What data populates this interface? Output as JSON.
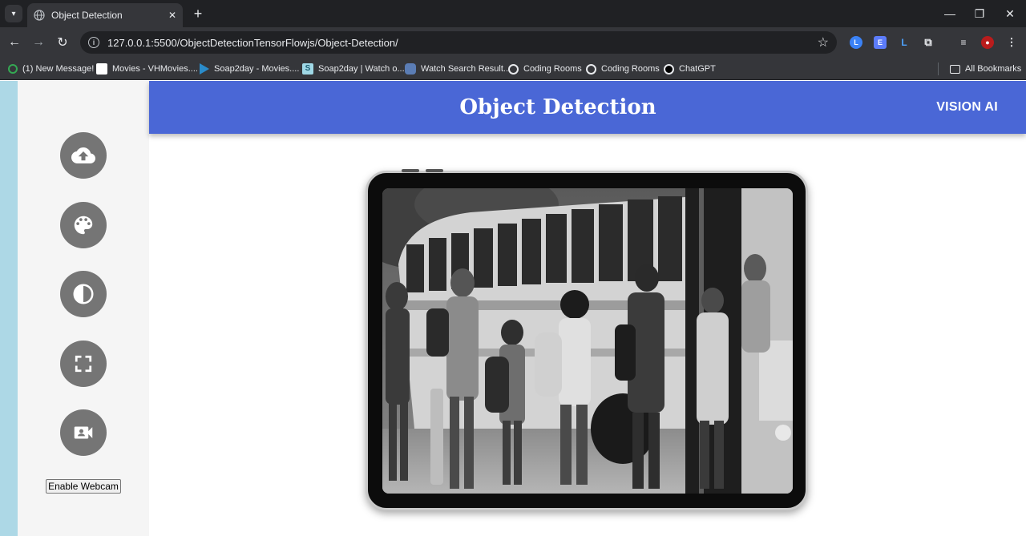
{
  "browser": {
    "tab_title": "Object Detection",
    "url": "127.0.0.1:5500/ObjectDetectionTensorFlowjs/Object-Detection/",
    "bookmarks": [
      {
        "label": "(1) New Message!",
        "icon": "green-circle-icon"
      },
      {
        "label": "Movies - VHMovies....",
        "icon": "white-page-icon"
      },
      {
        "label": "Soap2day - Movies....",
        "icon": "play-icon"
      },
      {
        "label": "Soap2day | Watch o...",
        "icon": "s-logo-icon"
      },
      {
        "label": "Watch Search Result...",
        "icon": "binoculars-icon"
      },
      {
        "label": "Coding Rooms",
        "icon": "coding-rooms-icon"
      },
      {
        "label": "Coding Rooms",
        "icon": "coding-rooms-icon"
      },
      {
        "label": "ChatGPT",
        "icon": "chatgpt-icon"
      }
    ],
    "all_bookmarks_label": "All Bookmarks"
  },
  "header": {
    "title": "Object Detection",
    "brand": "VISION AI",
    "color": "#4a67d6"
  },
  "sidebar": {
    "buttons": [
      {
        "name": "upload-button",
        "icon": "cloud-upload-icon"
      },
      {
        "name": "palette-button",
        "icon": "palette-icon"
      },
      {
        "name": "contrast-button",
        "icon": "contrast-icon"
      },
      {
        "name": "fullscreen-button",
        "icon": "fullscreen-icon"
      },
      {
        "name": "video-camera-button",
        "icon": "video-camera-icon"
      }
    ],
    "webcam_label": "Enable Webcam",
    "button_color": "#757575"
  },
  "main": {
    "image_subject": "grayscale-photo"
  }
}
